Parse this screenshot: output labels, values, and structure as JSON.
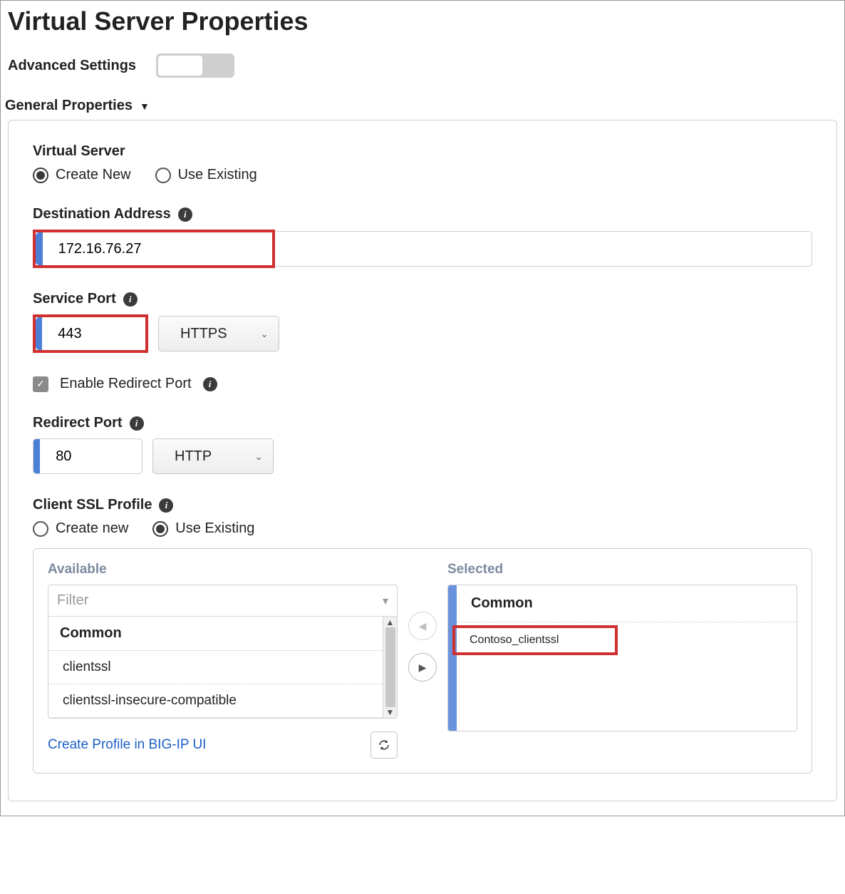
{
  "title": "Virtual Server Properties",
  "advanced": {
    "label": "Advanced Settings",
    "enabled": false
  },
  "section": {
    "header": "General Properties"
  },
  "virtualServer": {
    "groupLabel": "Virtual Server",
    "options": {
      "createNew": "Create New",
      "useExisting": "Use Existing"
    },
    "selected": "createNew"
  },
  "destAddress": {
    "label": "Destination Address",
    "value": "172.16.76.27"
  },
  "servicePort": {
    "label": "Service Port",
    "value": "443",
    "protocol": "HTTPS"
  },
  "enableRedirect": {
    "label": "Enable Redirect Port",
    "checked": true
  },
  "redirectPort": {
    "label": "Redirect Port",
    "value": "80",
    "protocol": "HTTP"
  },
  "clientSSL": {
    "label": "Client SSL Profile",
    "options": {
      "createNew": "Create new",
      "useExisting": "Use Existing"
    },
    "selected": "useExisting",
    "available": {
      "header": "Available",
      "filterPlaceholder": "Filter",
      "group": "Common",
      "items": [
        "clientssl",
        "clientssl-insecure-compatible"
      ]
    },
    "selectedList": {
      "header": "Selected",
      "group": "Common",
      "items": [
        "Contoso_clientssl"
      ]
    },
    "createLink": "Create Profile in BIG-IP UI"
  }
}
